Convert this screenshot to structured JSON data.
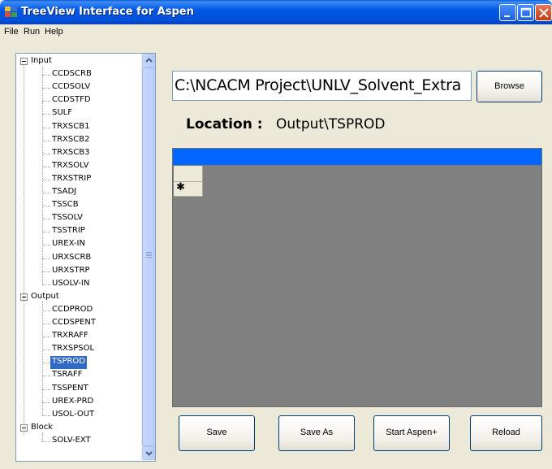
{
  "window": {
    "title": "TreeView Interface for Aspen"
  },
  "menu": {
    "items": [
      "File",
      "Run",
      "Help"
    ]
  },
  "tree": {
    "groups": [
      {
        "label": "Input",
        "expanded": true,
        "children": [
          "CCDSCRB",
          "CCDSOLV",
          "CCDSTFD",
          "SULF",
          "TRXSCB1",
          "TRXSCB2",
          "TRXSCB3",
          "TRXSOLV",
          "TRXSTRIP",
          "TSADJ",
          "TSSCB",
          "TSSOLV",
          "TSSTRIP",
          "UREX-IN",
          "URXSCRB",
          "URXSTRP",
          "USOLV-IN"
        ]
      },
      {
        "label": "Output",
        "expanded": true,
        "children": [
          "CCDPROD",
          "CCDSPENT",
          "TRXRAFF",
          "TRXSPSOL",
          "TSPROD",
          "TSRAFF",
          "TSSPENT",
          "UREX-PRD",
          "USOL-OUT"
        ]
      },
      {
        "label": "Block",
        "expanded": true,
        "children": [
          "SOLV-EXT"
        ]
      }
    ],
    "selected": "TSPROD"
  },
  "path": {
    "value": "C:\\NCACM Project\\UNLV_Solvent_Extra"
  },
  "buttons": {
    "browse": "Browse",
    "save": "Save",
    "save_as": "Save As",
    "start_aspen": "Start Aspen+",
    "reload": "Reload"
  },
  "location": {
    "label": "Location :",
    "value": "Output\\TSPROD"
  },
  "grid": {
    "new_row_glyph": "✱"
  },
  "colors": {
    "titlebar": "#0058e6",
    "grid_header": "#0066ff",
    "grid_bg": "#808080",
    "selection": "#316ac5"
  }
}
